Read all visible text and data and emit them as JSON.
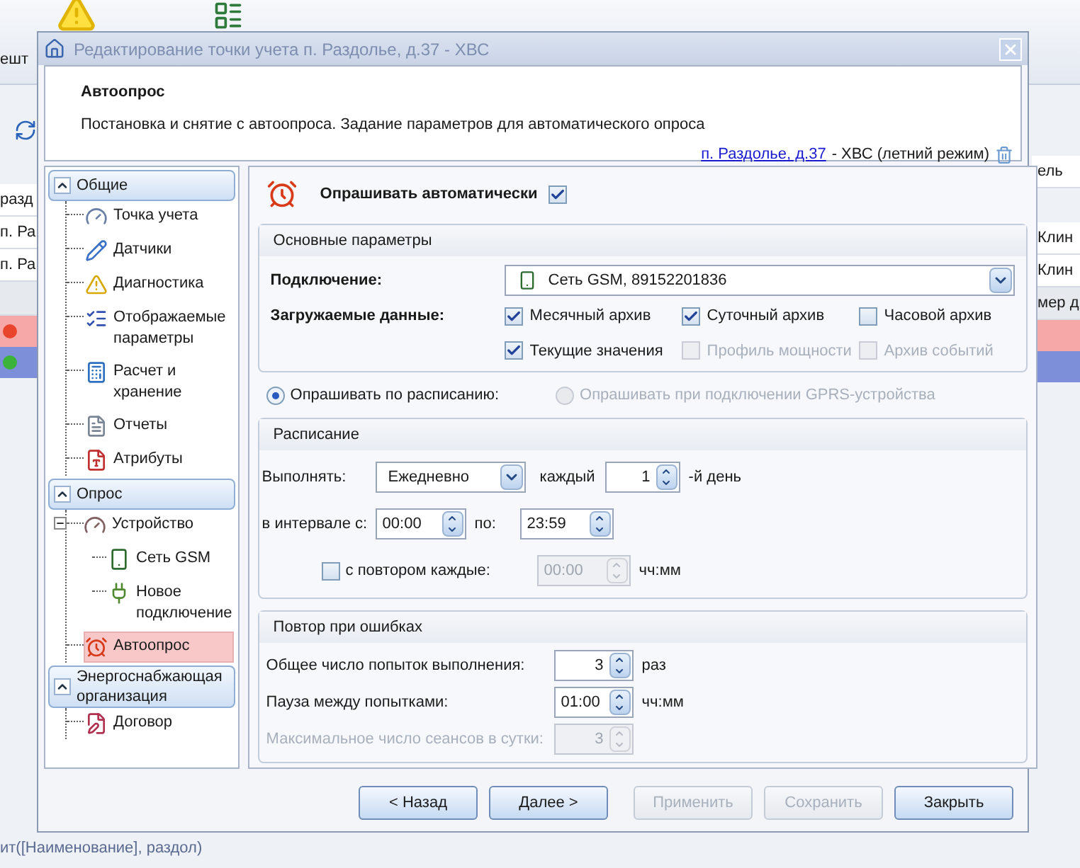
{
  "background": {
    "toolbar_label": "ешт",
    "left_cells": [
      "разд",
      "п. Ра",
      "п. Ра"
    ],
    "right_cells": [
      "ель",
      "Клин",
      "Клин",
      "мер д"
    ],
    "status_rows": [
      {
        "color": "#e8452c",
        "selected": false
      },
      {
        "color": "#3cb43c",
        "selected": true
      }
    ],
    "formula": "ит([Наименование], раздол)"
  },
  "window": {
    "title": "Редактирование точки учета п. Раздолье, д.37 - ХВС"
  },
  "header": {
    "title": "Автоопрос",
    "description": "Постановка и снятие с автоопроса. Задание параметров для автоматического опроса",
    "link": "п. Раздолье, д.37",
    "suffix": "- ХВС (летний режим)"
  },
  "nav": {
    "groups": [
      {
        "label": "Общие",
        "items": [
          {
            "label": "Точка учета",
            "kind": "meter",
            "selected": false
          },
          {
            "label": "Датчики",
            "kind": "sensor",
            "selected": false
          },
          {
            "label": "Диагностика",
            "kind": "warning",
            "selected": false
          },
          {
            "label": "Отображаемые параметры",
            "kind": "checklist",
            "selected": false
          },
          {
            "label": "Расчет и хранение",
            "kind": "calculator",
            "selected": false
          },
          {
            "label": "Отчеты",
            "kind": "document",
            "selected": false
          },
          {
            "label": "Атрибуты",
            "kind": "attributes",
            "selected": false
          }
        ]
      },
      {
        "label": "Опрос",
        "items": [
          {
            "label": "Устройство",
            "kind": "device",
            "selected": false,
            "expanded": true,
            "children": [
              {
                "label": "Сеть GSM",
                "kind": "phone",
                "selected": false
              },
              {
                "label": "Новое подключение",
                "kind": "connection",
                "selected": false
              }
            ]
          },
          {
            "label": "Автоопрос",
            "kind": "alarm",
            "selected": true
          }
        ]
      },
      {
        "label": "Энергоснабжающая организация",
        "items": [
          {
            "label": "Договор",
            "kind": "contract",
            "selected": false
          }
        ]
      }
    ]
  },
  "auto_poll": {
    "label": "Опрашивать автоматически",
    "checked": true
  },
  "main_params": {
    "title": "Основные параметры",
    "connection_label": "Подключение:",
    "connection_value": "Сеть GSM, 89152201836",
    "data_label": "Загружаемые данные:",
    "data_options": [
      {
        "label": "Месячный архив",
        "checked": true,
        "disabled": false
      },
      {
        "label": "Суточный архив",
        "checked": true,
        "disabled": false
      },
      {
        "label": "Часовой архив",
        "checked": false,
        "disabled": false
      },
      {
        "label": "Текущие значения",
        "checked": true,
        "disabled": false
      },
      {
        "label": "Профиль мощности",
        "checked": false,
        "disabled": true
      },
      {
        "label": "Архив событий",
        "checked": false,
        "disabled": true
      }
    ]
  },
  "mode_options": [
    {
      "label": "Опрашивать по расписанию:",
      "selected": true,
      "disabled": false
    },
    {
      "label": "Опрашивать при подключении GPRS-устройства",
      "selected": false,
      "disabled": true
    }
  ],
  "schedule": {
    "title": "Расписание",
    "run_label": "Выполнять:",
    "run_value": "Ежедневно",
    "every_label": "каждый",
    "every_value": "1",
    "every_suffix": "-й день",
    "interval_label": "в интервале с:",
    "from": "00:00",
    "to_label": "по:",
    "to": "23:59",
    "repeat": {
      "label": "с повтором каждые:",
      "checked": false,
      "value": "00:00",
      "unit": "чч:мм"
    }
  },
  "retry": {
    "title": "Повтор при ошибках",
    "rows": [
      {
        "label": "Общее число попыток выполнения:",
        "value": "3",
        "unit": "раз",
        "disabled": false
      },
      {
        "label": "Пауза между попытками:",
        "value": "01:00",
        "unit": "чч:мм",
        "disabled": false
      },
      {
        "label": "Максимальное число сеансов в сутки:",
        "value": "3",
        "disabled": true
      }
    ]
  },
  "buttons": [
    {
      "label": "< Назад",
      "disabled": false
    },
    {
      "label": "Далее >",
      "disabled": false
    },
    {
      "label": "Применить",
      "disabled": true
    },
    {
      "label": "Сохранить",
      "disabled": true
    },
    {
      "label": "Закрыть",
      "disabled": false
    }
  ]
}
